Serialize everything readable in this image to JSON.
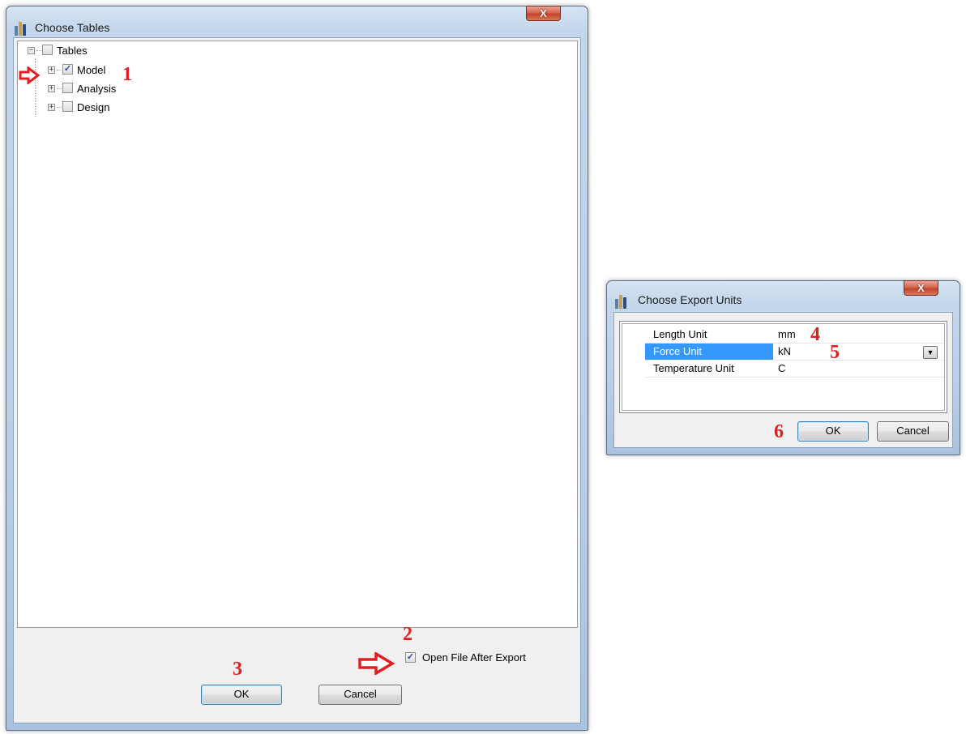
{
  "choose_tables": {
    "title": "Choose Tables",
    "close_glyph": "X",
    "tree": {
      "root": "Tables",
      "nodes": [
        {
          "label": "Model",
          "checked": true
        },
        {
          "label": "Analysis",
          "checked": false
        },
        {
          "label": "Design",
          "checked": false
        }
      ]
    },
    "open_after_export_label": "Open File After Export",
    "open_after_export_checked": true,
    "ok_label": "OK",
    "cancel_label": "Cancel"
  },
  "export_units": {
    "title": "Choose Export Units",
    "close_glyph": "X",
    "rows": [
      {
        "name": "Length Unit",
        "value": "mm"
      },
      {
        "name": "Force Unit",
        "value": "kN"
      },
      {
        "name": "Temperature Unit",
        "value": "C"
      }
    ],
    "ok_label": "OK",
    "cancel_label": "Cancel"
  },
  "annotations": {
    "n1": "1",
    "n2": "2",
    "n3": "3",
    "n4": "4",
    "n5": "5",
    "n6": "6"
  },
  "colors": {
    "annotation": "#e02020",
    "selection": "#3399ff"
  }
}
